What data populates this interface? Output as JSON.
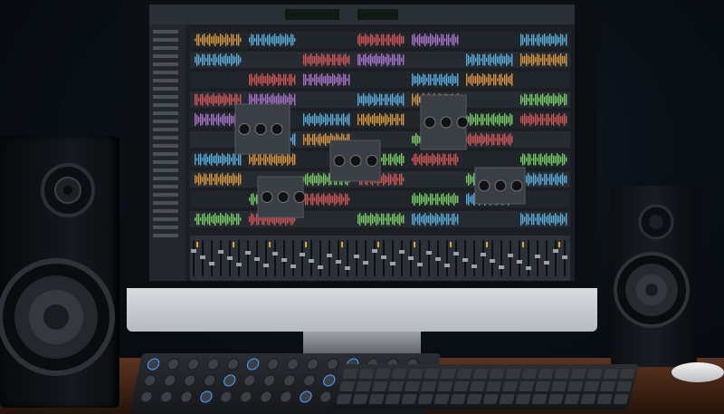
{
  "scene": {
    "description_visible_text": "",
    "colors": {
      "background": "#06090d",
      "monitor_bezel": "#0d0f12",
      "monitor_chin": "#c9ccd0",
      "screen_base": "#1b1f24",
      "speaker_body": "#111418",
      "speaker_cone": "#2a2d31",
      "desk": "#4a2a17",
      "keyboard": "#1a1c1f",
      "waveform_orange": "#e6a040",
      "waveform_green": "#7fd86a",
      "waveform_blue": "#5fb7e8",
      "waveform_red": "#e05a5a",
      "waveform_purple": "#b57ad8"
    },
    "objects": [
      "left-studio-monitor-speaker",
      "right-studio-monitor-speaker",
      "desktop-monitor-with-daw",
      "mixing-console-controller",
      "computer-keyboard",
      "mouse",
      "wooden-desk"
    ]
  }
}
